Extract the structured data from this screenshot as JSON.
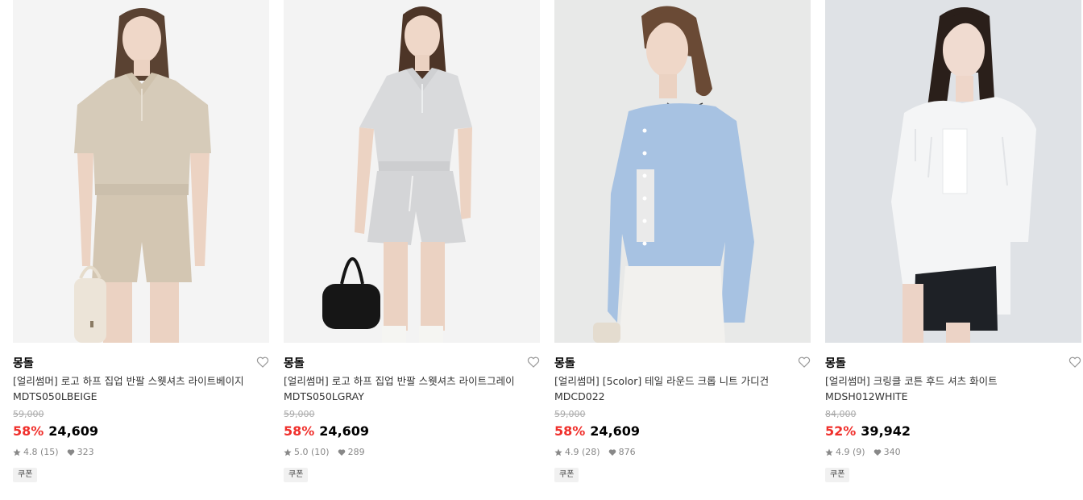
{
  "products": [
    {
      "brand": "몽돌",
      "title": "[얼리썸머] 로고 하프 집업 반팔 스웻셔츠 라이트베이지",
      "code": "MDTS050LBEIGE",
      "original_price": "59,000",
      "discount": "58%",
      "price": "24,609",
      "rating": "4.8",
      "reviews": "(15)",
      "likes": "323",
      "coupon": "쿠폰",
      "image": {
        "background": "#f4f4f4",
        "top_color": "#d6cbb9",
        "bottom_color": "#d3c6b2",
        "hair": "#5a4232",
        "accessory": "handbag-beige"
      }
    },
    {
      "brand": "몽돌",
      "title": "[얼리썸머] 로고 하프 집업 반팔 스웻셔츠 라이트그레이",
      "code": "MDTS050LGRAY",
      "original_price": "59,000",
      "discount": "58%",
      "price": "24,609",
      "rating": "5.0",
      "reviews": "(10)",
      "likes": "289",
      "coupon": "쿠폰",
      "image": {
        "background": "#f3f3f3",
        "top_color": "#d9dadc",
        "bottom_color": "#d4d5d7",
        "hair": "#4d3527",
        "accessory": "handbag-black"
      }
    },
    {
      "brand": "몽돌",
      "title": "[얼리썸머] [5color] 테일 라운드 크롭 니트 가디건",
      "code": "MDCD022",
      "original_price": "59,000",
      "discount": "58%",
      "price": "24,609",
      "rating": "4.9",
      "reviews": "(28)",
      "likes": "876",
      "coupon": "쿠폰",
      "image": {
        "background": "#e8e9e8",
        "top_color": "#a7c2e2",
        "bottom_color": "#f2f1ee",
        "hair": "#6a4a35",
        "accessory": "clutch"
      }
    },
    {
      "brand": "몽돌",
      "title": "[얼리썸머] 크링클 코튼 후드 셔츠 화이트",
      "code": "MDSH012WHITE",
      "original_price": "84,000",
      "discount": "52%",
      "price": "39,942",
      "rating": "4.9",
      "reviews": "(9)",
      "likes": "340",
      "coupon": "쿠폰",
      "image": {
        "background": "#dfe2e6",
        "top_color": "#f4f5f6",
        "bottom_color": "#1e2126",
        "hair": "#2a1f1a",
        "accessory": "none"
      }
    }
  ]
}
